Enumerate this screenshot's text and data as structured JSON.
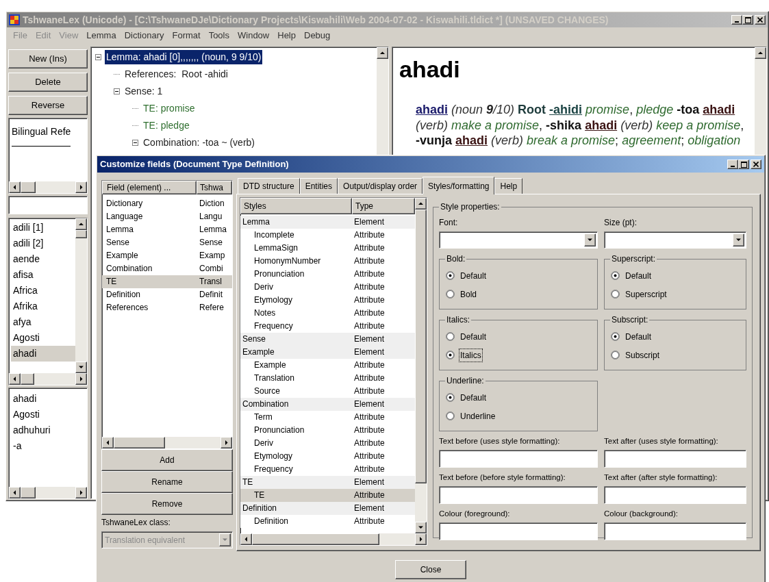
{
  "main_window": {
    "title": "TshwaneLex (Unicode) - [C:\\TshwaneDJe\\Dictionary Projects\\Kiswahili\\Web 2004-07-02 - Kiswahili.tldict *] (UNSAVED CHANGES)",
    "menu": [
      {
        "label": "File",
        "disabled": true
      },
      {
        "label": "Edit",
        "disabled": true
      },
      {
        "label": "View",
        "disabled": true
      },
      {
        "label": "Lemma",
        "disabled": false
      },
      {
        "label": "Dictionary",
        "disabled": false
      },
      {
        "label": "Format",
        "disabled": false
      },
      {
        "label": "Tools",
        "disabled": false
      },
      {
        "label": "Window",
        "disabled": false
      },
      {
        "label": "Help",
        "disabled": false
      },
      {
        "label": "Debug",
        "disabled": false
      }
    ],
    "buttons": [
      "New (Ins)",
      "Delete",
      "Reverse"
    ],
    "bilingual_box": {
      "text": "Bilingual Refe"
    },
    "lemma_list": [
      {
        "label": "adili [1]",
        "selected": false
      },
      {
        "label": "adili [2]",
        "selected": false
      },
      {
        "label": "aende",
        "selected": false
      },
      {
        "label": "afisa",
        "selected": false
      },
      {
        "label": "Africa",
        "selected": false
      },
      {
        "label": "Afrika",
        "selected": false
      },
      {
        "label": "afya",
        "selected": false
      },
      {
        "label": "Agosti",
        "selected": false
      },
      {
        "label": "ahadi",
        "selected": true
      }
    ],
    "history_list": [
      "ahadi",
      "Agosti",
      "adhuhuri",
      "-a"
    ],
    "tree": [
      {
        "label": "Lemma: ahadi [0],,,,,,, (noun, 9 9/10)",
        "selected": true,
        "expanded": true,
        "children": [
          {
            "label": "References:  Root -ahidi",
            "kind": "field",
            "selected": false
          },
          {
            "label": "Sense: 1",
            "kind": "field",
            "selected": false,
            "expanded": true,
            "children": [
              {
                "label": "TE: promise",
                "kind": "te",
                "selected": false
              },
              {
                "label": "TE: pledge",
                "kind": "te",
                "selected": false
              },
              {
                "label": "Combination: -toa ~ (verb)",
                "kind": "field",
                "selected": false,
                "expanded": true
              }
            ]
          }
        ]
      }
    ],
    "preview": {
      "headword": "ahadi",
      "entry": [
        {
          "text": "ahadi",
          "kind": "hw"
        },
        {
          "text": " (noun ",
          "kind": "it"
        },
        {
          "text": "9",
          "kind": "itb"
        },
        {
          "text": "/10) ",
          "kind": "it"
        },
        {
          "text": "Root ",
          "kind": "lab"
        },
        {
          "text": "-ahidi",
          "kind": "ref"
        },
        {
          "text": " promise",
          "kind": "te"
        },
        {
          "text": ", ",
          "kind": "p"
        },
        {
          "text": "pledge ",
          "kind": "te"
        },
        {
          "text": "-toa ",
          "kind": "term"
        },
        {
          "text": "ahadi",
          "kind": "tref"
        },
        {
          "text": " (verb) ",
          "kind": "it"
        },
        {
          "text": "make a promise",
          "kind": "te"
        },
        {
          "text": ", ",
          "kind": "p"
        },
        {
          "text": "-shika ",
          "kind": "term"
        },
        {
          "text": "ahadi",
          "kind": "tref"
        },
        {
          "text": " (verb) ",
          "kind": "it"
        },
        {
          "text": "keep a promise",
          "kind": "te"
        },
        {
          "text": ", ",
          "kind": "p"
        },
        {
          "text": "-vunja ",
          "kind": "term"
        },
        {
          "text": "ahadi",
          "kind": "tref"
        },
        {
          "text": " (verb) ",
          "kind": "it"
        },
        {
          "text": "break a promise",
          "kind": "te"
        },
        {
          "text": "; ",
          "kind": "p"
        },
        {
          "text": "agreement",
          "kind": "te"
        },
        {
          "text": "; ",
          "kind": "p"
        },
        {
          "text": "obligation",
          "kind": "te"
        }
      ]
    }
  },
  "dialog": {
    "title": "Customize fields (Document Type Definition)",
    "field_list": {
      "columns": [
        "Field (element) ...",
        "Tshwa"
      ],
      "rows": [
        {
          "field": "Dictionary",
          "class": "Diction",
          "selected": false
        },
        {
          "field": "Language",
          "class": "Langu",
          "selected": false
        },
        {
          "field": "Lemma",
          "class": "Lemma",
          "selected": false
        },
        {
          "field": "Sense",
          "class": "Sense",
          "selected": false
        },
        {
          "field": "Example",
          "class": "Examp",
          "selected": false
        },
        {
          "field": "Combination",
          "class": "Combi",
          "selected": false
        },
        {
          "field": "TE",
          "class": "Transl",
          "selected": true
        },
        {
          "field": "Definition",
          "class": "Definit",
          "selected": false
        },
        {
          "field": "References",
          "class": "Refere",
          "selected": false
        }
      ]
    },
    "buttons": [
      "Add",
      "Rename",
      "Remove"
    ],
    "class_label": "TshwaneLex class:",
    "class_select": {
      "value": "Translation equivalent",
      "disabled": true
    },
    "tabs": [
      {
        "label": "DTD structure",
        "selected": false
      },
      {
        "label": "Entities",
        "selected": false
      },
      {
        "label": "Output/display order",
        "selected": false
      },
      {
        "label": "Styles/formatting",
        "selected": true
      },
      {
        "label": "Help",
        "selected": false
      }
    ],
    "styles_list": {
      "columns": [
        "Styles",
        "Type"
      ],
      "rows": [
        {
          "name": "Lemma",
          "type": "Element",
          "selected": false,
          "children": [
            {
              "name": "Incomplete",
              "type": "Attribute",
              "selected": false
            },
            {
              "name": "LemmaSign",
              "type": "Attribute",
              "selected": false
            },
            {
              "name": "HomonymNumber",
              "type": "Attribute",
              "selected": false
            },
            {
              "name": "Pronunciation",
              "type": "Attribute",
              "selected": false
            },
            {
              "name": "Deriv",
              "type": "Attribute",
              "selected": false
            },
            {
              "name": "Etymology",
              "type": "Attribute",
              "selected": false
            },
            {
              "name": "Notes",
              "type": "Attribute",
              "selected": false
            },
            {
              "name": "Frequency",
              "type": "Attribute",
              "selected": false
            }
          ]
        },
        {
          "name": "Sense",
          "type": "Element",
          "selected": false
        },
        {
          "name": "Example",
          "type": "Element",
          "selected": false,
          "children": [
            {
              "name": "Example",
              "type": "Attribute",
              "selected": false
            },
            {
              "name": "Translation",
              "type": "Attribute",
              "selected": false
            },
            {
              "name": "Source",
              "type": "Attribute",
              "selected": false
            }
          ]
        },
        {
          "name": "Combination",
          "type": "Element",
          "selected": false,
          "children": [
            {
              "name": "Term",
              "type": "Attribute",
              "selected": false
            },
            {
              "name": "Pronunciation",
              "type": "Attribute",
              "selected": false
            },
            {
              "name": "Deriv",
              "type": "Attribute",
              "selected": false
            },
            {
              "name": "Etymology",
              "type": "Attribute",
              "selected": false
            },
            {
              "name": "Frequency",
              "type": "Attribute",
              "selected": false
            }
          ]
        },
        {
          "name": "TE",
          "type": "Element",
          "selected": false,
          "children": [
            {
              "name": "TE",
              "type": "Attribute",
              "selected": true
            }
          ]
        },
        {
          "name": "Definition",
          "type": "Element",
          "selected": false,
          "children": [
            {
              "name": "Definition",
              "type": "Attribute",
              "selected": false
            }
          ]
        }
      ]
    },
    "style_properties": {
      "title": "Style properties:",
      "font_label": "Font:",
      "size_label": "Size (pt):",
      "groups": [
        {
          "title": "Bold:",
          "options": [
            {
              "label": "Default",
              "selected": true,
              "focused": false
            },
            {
              "label": "Bold",
              "selected": false,
              "focused": false
            }
          ]
        },
        {
          "title": "Superscript:",
          "options": [
            {
              "label": "Default",
              "selected": true,
              "focused": false
            },
            {
              "label": "Superscript",
              "selected": false,
              "focused": false
            }
          ]
        },
        {
          "title": "Italics:",
          "options": [
            {
              "label": "Default",
              "selected": false,
              "focused": false
            },
            {
              "label": "Italics",
              "selected": true,
              "focused": true
            }
          ]
        },
        {
          "title": "Subscript:",
          "options": [
            {
              "label": "Default",
              "selected": true,
              "focused": false
            },
            {
              "label": "Subscript",
              "selected": false,
              "focused": false
            }
          ]
        },
        {
          "title": "Underline:",
          "options": [
            {
              "label": "Default",
              "selected": true,
              "focused": false
            },
            {
              "label": "Underline",
              "selected": false,
              "focused": false
            }
          ]
        }
      ],
      "text_fields": [
        {
          "label": "Text before (uses style formatting):"
        },
        {
          "label": "Text after (uses style formatting):"
        },
        {
          "label": "Text before (before style formatting):"
        },
        {
          "label": "Text after (after style formatting):"
        },
        {
          "label": "Colour (foreground):"
        },
        {
          "label": "Colour (background):"
        }
      ]
    },
    "close_button": "Close"
  }
}
